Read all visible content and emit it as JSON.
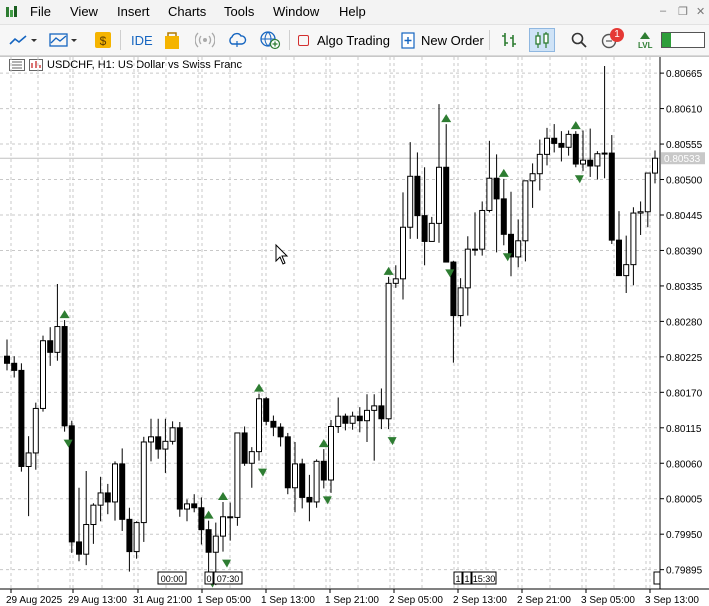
{
  "menu": {
    "file": "File",
    "view": "View",
    "insert": "Insert",
    "charts": "Charts",
    "tools": "Tools",
    "window": "Window",
    "help": "Help"
  },
  "toolbar": {
    "ide": "IDE",
    "algo_trading": "Algo Trading",
    "new_order": "New Order",
    "notification_count": "1",
    "lvl": "LVL"
  },
  "chart": {
    "symbol_title": "USDCHF, H1:  US Dollar vs Swiss Franc",
    "current_price": "0.80533",
    "price_labels": [
      "0.80665",
      "0.80610",
      "0.80555",
      "0.80500",
      "0.80445",
      "0.80390",
      "0.80335",
      "0.80280",
      "0.80225",
      "0.80170",
      "0.80115",
      "0.80060",
      "0.80005",
      "0.79950",
      "0.79895"
    ],
    "time_labels": [
      "29 Aug 2025",
      "29 Aug 13:00",
      "31 Aug 21:00",
      "1 Sep 05:00",
      "1 Sep 13:00",
      "1 Sep 21:00",
      "2 Sep 05:00",
      "2 Sep 13:00",
      "2 Sep 21:00",
      "3 Sep 05:00",
      "3 Sep 13:00"
    ],
    "session_markers": [
      "00:00",
      "0",
      "07:30",
      "1",
      "1",
      "15:30"
    ]
  },
  "colors": {
    "bull_candle": "#ffffff",
    "bear_candle": "#000000",
    "grid": "#c8c8c8",
    "arrow_green": "#2e7d32",
    "price_line": "#c0c0c0"
  },
  "chart_data": {
    "type": "candlestick",
    "symbol": "USDCHF",
    "timeframe": "H1",
    "ylim": [
      0.79865,
      0.8069
    ],
    "last_price": 0.80533,
    "candles": [
      [
        0.80226,
        0.80252,
        0.80204,
        0.80215
      ],
      [
        0.80215,
        0.80226,
        0.80193,
        0.80204
      ],
      [
        0.80204,
        0.80215,
        0.80047,
        0.80055
      ],
      [
        0.80055,
        0.80102,
        0.79978,
        0.80076
      ],
      [
        0.80076,
        0.80154,
        0.8005,
        0.80145
      ],
      [
        0.80145,
        0.80258,
        0.8014,
        0.8025
      ],
      [
        0.8025,
        0.80271,
        0.80211,
        0.80232
      ],
      [
        0.80232,
        0.80338,
        0.80219,
        0.80272
      ],
      [
        0.80272,
        0.80282,
        0.80109,
        0.80118
      ],
      [
        0.80118,
        0.80126,
        0.79921,
        0.79938
      ],
      [
        0.79938,
        0.80022,
        0.79908,
        0.79919
      ],
      [
        0.79919,
        0.80048,
        0.79902,
        0.79965
      ],
      [
        0.79965,
        0.79998,
        0.79935,
        0.79995
      ],
      [
        0.79995,
        0.80039,
        0.7997,
        0.80014
      ],
      [
        0.80014,
        0.80028,
        0.79981,
        0.8
      ],
      [
        0.8,
        0.80063,
        0.79971,
        0.80059
      ],
      [
        0.80059,
        0.80083,
        0.79955,
        0.79973
      ],
      [
        0.79973,
        0.79991,
        0.79892,
        0.79923
      ],
      [
        0.79923,
        0.7997,
        0.79912,
        0.79968
      ],
      [
        0.79968,
        0.80101,
        0.79938,
        0.80093
      ],
      [
        0.80093,
        0.80129,
        0.80063,
        0.80101
      ],
      [
        0.80101,
        0.80129,
        0.80067,
        0.80082
      ],
      [
        0.80082,
        0.80129,
        0.80045,
        0.80094
      ],
      [
        0.80094,
        0.80125,
        0.80089,
        0.80115
      ],
      [
        0.80115,
        0.80124,
        0.79977,
        0.79989
      ],
      [
        0.79989,
        0.80004,
        0.7997,
        0.79997
      ],
      [
        0.79997,
        0.80012,
        0.79984,
        0.79991
      ],
      [
        0.79991,
        0.80007,
        0.79934,
        0.79957
      ],
      [
        0.79957,
        0.79971,
        0.79892,
        0.79922
      ],
      [
        0.79922,
        0.79968,
        0.79871,
        0.79947
      ],
      [
        0.79947,
        0.8,
        0.79923,
        0.79977
      ],
      [
        0.79977,
        0.79999,
        0.7994,
        0.79976
      ],
      [
        0.79976,
        0.80107,
        0.79963,
        0.80107
      ],
      [
        0.80107,
        0.80117,
        0.80056,
        0.8006
      ],
      [
        0.8006,
        0.80085,
        0.80022,
        0.80078
      ],
      [
        0.80078,
        0.80168,
        0.80064,
        0.8016
      ],
      [
        0.8016,
        0.80163,
        0.80119,
        0.80125
      ],
      [
        0.80125,
        0.80134,
        0.80102,
        0.80116
      ],
      [
        0.80116,
        0.80122,
        0.80086,
        0.80101
      ],
      [
        0.80101,
        0.80107,
        0.80012,
        0.80022
      ],
      [
        0.80022,
        0.80093,
        0.79984,
        0.80059
      ],
      [
        0.80059,
        0.80067,
        0.7999,
        0.80007
      ],
      [
        0.80007,
        0.80042,
        0.7997,
        0.8
      ],
      [
        0.8,
        0.80066,
        0.79991,
        0.80063
      ],
      [
        0.80063,
        0.80082,
        0.80021,
        0.80034
      ],
      [
        0.80034,
        0.80127,
        0.80014,
        0.80117
      ],
      [
        0.80117,
        0.80162,
        0.80107,
        0.80133
      ],
      [
        0.80133,
        0.80137,
        0.80111,
        0.80122
      ],
      [
        0.80122,
        0.8014,
        0.80112,
        0.80133
      ],
      [
        0.80133,
        0.80147,
        0.80108,
        0.80126
      ],
      [
        0.80126,
        0.80167,
        0.80093,
        0.80142
      ],
      [
        0.80142,
        0.80167,
        0.80064,
        0.80149
      ],
      [
        0.80149,
        0.80176,
        0.80113,
        0.80129
      ],
      [
        0.80129,
        0.80349,
        0.80113,
        0.80339
      ],
      [
        0.80339,
        0.80367,
        0.80332,
        0.80346
      ],
      [
        0.80346,
        0.8048,
        0.80314,
        0.80426
      ],
      [
        0.80426,
        0.80558,
        0.80408,
        0.80505
      ],
      [
        0.80505,
        0.80542,
        0.80408,
        0.80444
      ],
      [
        0.80444,
        0.80519,
        0.80367,
        0.80404
      ],
      [
        0.80404,
        0.80442,
        0.80414,
        0.80432
      ],
      [
        0.80432,
        0.80617,
        0.80402,
        0.80519
      ],
      [
        0.80519,
        0.80586,
        0.80373,
        0.80372
      ],
      [
        0.80372,
        0.80374,
        0.80216,
        0.80289
      ],
      [
        0.80289,
        0.80347,
        0.80272,
        0.80332
      ],
      [
        0.80332,
        0.80412,
        0.80289,
        0.80392
      ],
      [
        0.80392,
        0.80449,
        0.80382,
        0.80392
      ],
      [
        0.80392,
        0.80466,
        0.80382,
        0.80452
      ],
      [
        0.80452,
        0.8056,
        0.80449,
        0.80502
      ],
      [
        0.80502,
        0.80539,
        0.80387,
        0.8047
      ],
      [
        0.8047,
        0.80501,
        0.80398,
        0.80415
      ],
      [
        0.80415,
        0.80481,
        0.8035,
        0.8038
      ],
      [
        0.8038,
        0.80438,
        0.80364,
        0.80405
      ],
      [
        0.80405,
        0.80495,
        0.80373,
        0.80498
      ],
      [
        0.80498,
        0.80525,
        0.80456,
        0.80509
      ],
      [
        0.80509,
        0.80562,
        0.80483,
        0.80539
      ],
      [
        0.80539,
        0.8058,
        0.80522,
        0.80564
      ],
      [
        0.80564,
        0.80586,
        0.80542,
        0.80556
      ],
      [
        0.80556,
        0.80575,
        0.80528,
        0.8055
      ],
      [
        0.8055,
        0.80576,
        0.80537,
        0.8057
      ],
      [
        0.8057,
        0.80575,
        0.80519,
        0.80524
      ],
      [
        0.80524,
        0.80576,
        0.80513,
        0.8053
      ],
      [
        0.8053,
        0.80579,
        0.80504,
        0.80521
      ],
      [
        0.80521,
        0.80544,
        0.805,
        0.8054
      ],
      [
        0.8054,
        0.80676,
        0.80502,
        0.80541
      ],
      [
        0.80541,
        0.80569,
        0.804,
        0.80406
      ],
      [
        0.80406,
        0.80451,
        0.80359,
        0.80351
      ],
      [
        0.80351,
        0.80413,
        0.80324,
        0.80368
      ],
      [
        0.80368,
        0.80457,
        0.80336,
        0.80448
      ],
      [
        0.80448,
        0.80466,
        0.80414,
        0.8045
      ],
      [
        0.8045,
        0.8051,
        0.80426,
        0.8051
      ],
      [
        0.8051,
        0.80545,
        0.80494,
        0.80533
      ]
    ],
    "buy_arrows_index": [
      8,
      28,
      30,
      35,
      44,
      53,
      61,
      69,
      79,
      91
    ]
  }
}
